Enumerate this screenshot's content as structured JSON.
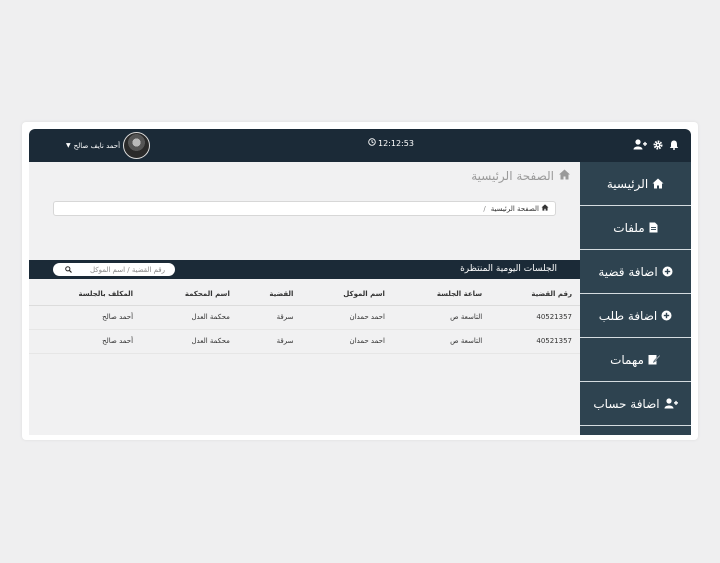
{
  "topbar": {
    "time": "12:12:53",
    "user_name": "أحمد نايف صالح",
    "icons": [
      "bell-icon",
      "gear-icon",
      "user-plus-icon",
      "clock-icon",
      "caret-down-icon"
    ]
  },
  "sidebar": {
    "items": [
      {
        "label": "الرئيسية",
        "icon": "home-icon"
      },
      {
        "label": "ملفات",
        "icon": "file-icon"
      },
      {
        "label": "اضافة قضية",
        "icon": "plus-circle-icon"
      },
      {
        "label": "اضافة طلب",
        "icon": "plus-circle-icon"
      },
      {
        "label": "مهمات",
        "icon": "edit-icon"
      },
      {
        "label": "اضافة حساب",
        "icon": "user-plus-icon"
      }
    ]
  },
  "main": {
    "page_title": "الصفحة الرئيسية",
    "breadcrumb": {
      "current": "الصفحة الرئيسية",
      "separator": "/"
    }
  },
  "sessions": {
    "title": "الجلسات اليومية المنتظرة",
    "search_placeholder": "رقم القضية / اسم الموكل",
    "columns": [
      "رقم القضية",
      "ساعة الجلسة",
      "اسم الموكل",
      "القضية",
      "اسم المحكمة",
      "المكلف بالجلسة"
    ],
    "rows": [
      [
        "40521357",
        "التاسعة ص",
        "احمد حمدان",
        "سرقة",
        "محكمة العدل",
        "أحمد صالح"
      ],
      [
        "40521357",
        "التاسعة ص",
        "احمد حمدان",
        "سرقة",
        "محكمة العدل",
        "أحمد صالح"
      ]
    ]
  },
  "colors": {
    "topbar_bg": "#1b2a37",
    "sidebar_bg": "#2e4350",
    "page_bg": "#efeff0"
  }
}
